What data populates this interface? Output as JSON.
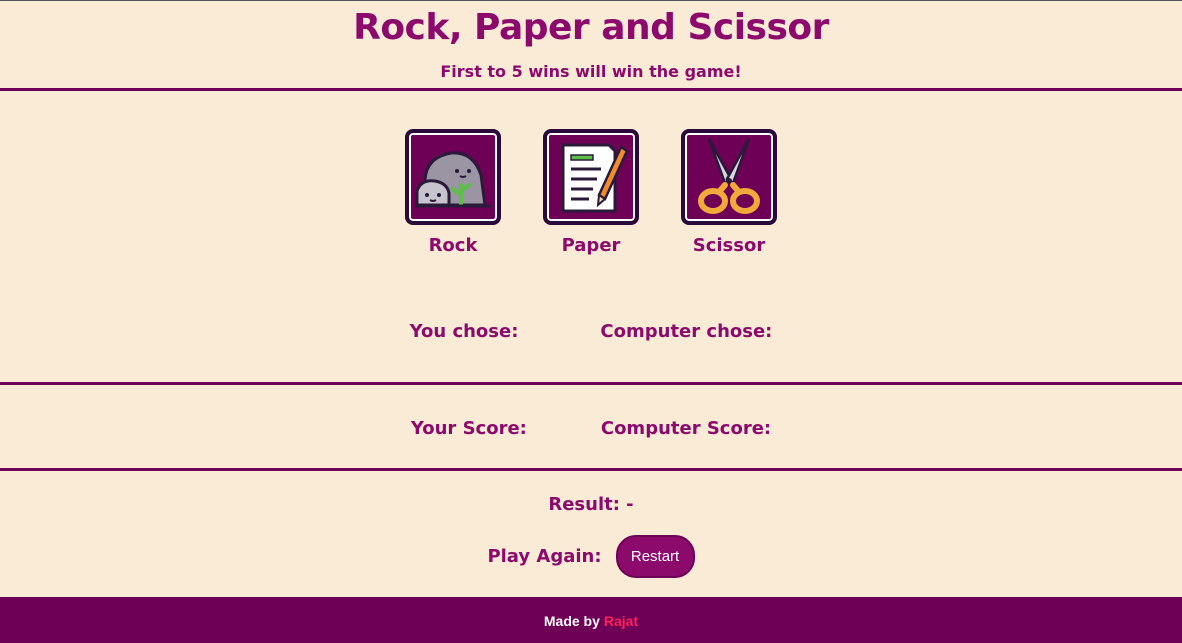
{
  "header": {
    "title": "Rock, Paper and Scissor",
    "subtitle": "First to 5 wins will win the game!"
  },
  "choices": [
    {
      "label": "Rock",
      "icon": "rock-icon"
    },
    {
      "label": "Paper",
      "icon": "paper-icon"
    },
    {
      "label": "Scissor",
      "icon": "scissor-icon"
    }
  ],
  "selection": {
    "you_label": "You chose:",
    "computer_label": "Computer chose:"
  },
  "score": {
    "you_label": "Your Score:",
    "computer_label": "Computer Score:"
  },
  "result": {
    "label": "Result: -"
  },
  "play_again": {
    "label": "Play Again:",
    "button_label": "Restart"
  },
  "footer": {
    "made_by": "Made by",
    "author": "Rajat"
  },
  "colors": {
    "background": "#FAEBD7",
    "accent": "#8B0A6C",
    "dark_accent": "#6E0055",
    "author_link": "#FF1F5A"
  }
}
